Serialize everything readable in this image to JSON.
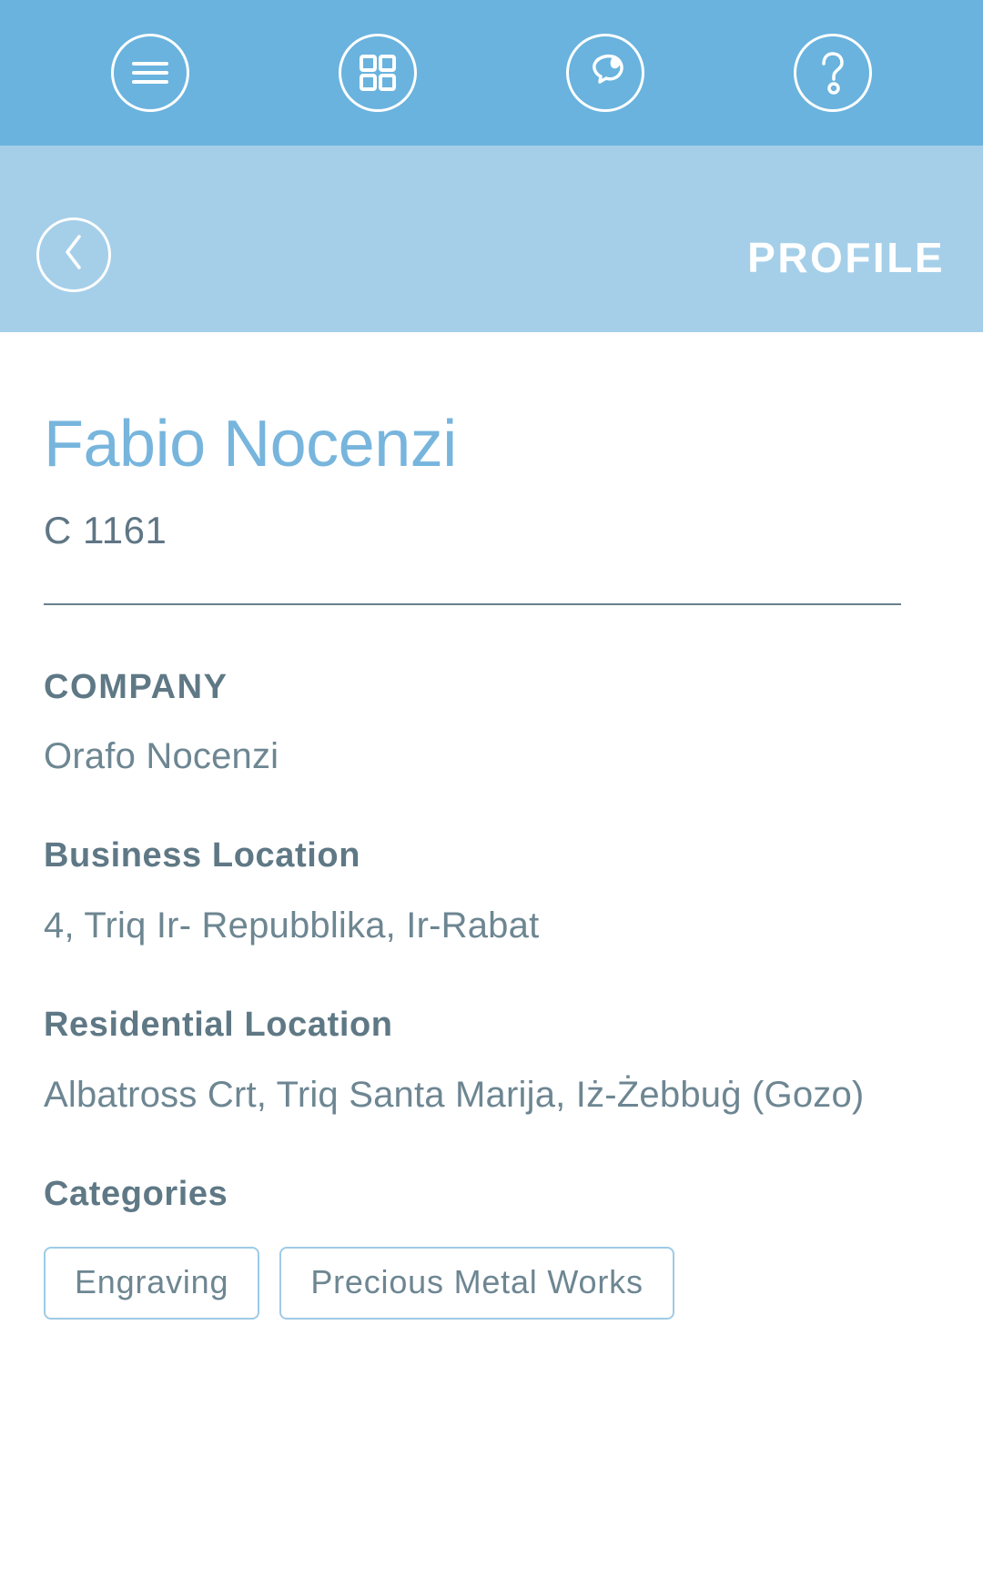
{
  "appbar": {
    "buttons": [
      {
        "name": "menu-icon",
        "label": "Menu"
      },
      {
        "name": "grid-icon",
        "label": "Dashboard"
      },
      {
        "name": "chat-icon",
        "label": "Messages"
      },
      {
        "name": "help-icon",
        "label": "Help"
      }
    ]
  },
  "header": {
    "back_label": "Back",
    "title": "PROFILE"
  },
  "profile": {
    "name": "Fabio Nocenzi",
    "id": "C 1161",
    "fields": [
      {
        "label": "COMPANY",
        "value": "Orafo Nocenzi"
      },
      {
        "label": "Business Location",
        "value": "4, Triq Ir- Repubblika, Ir-Rabat"
      },
      {
        "label": "Residential Location",
        "value": "Albatross Crt, Triq Santa Marija, Iż-Żebbuġ (Gozo)"
      }
    ],
    "categories_label": "Categories",
    "categories": [
      "Engraving",
      "Precious Metal Works"
    ]
  },
  "colors": {
    "appbar_blue": "#69b3de",
    "subheader_blue": "#a5cfe9",
    "name_blue": "#77b5dd",
    "text_slate": "#6d8692",
    "label_slate": "#5f7885",
    "chip_border": "#9ecbe6"
  }
}
